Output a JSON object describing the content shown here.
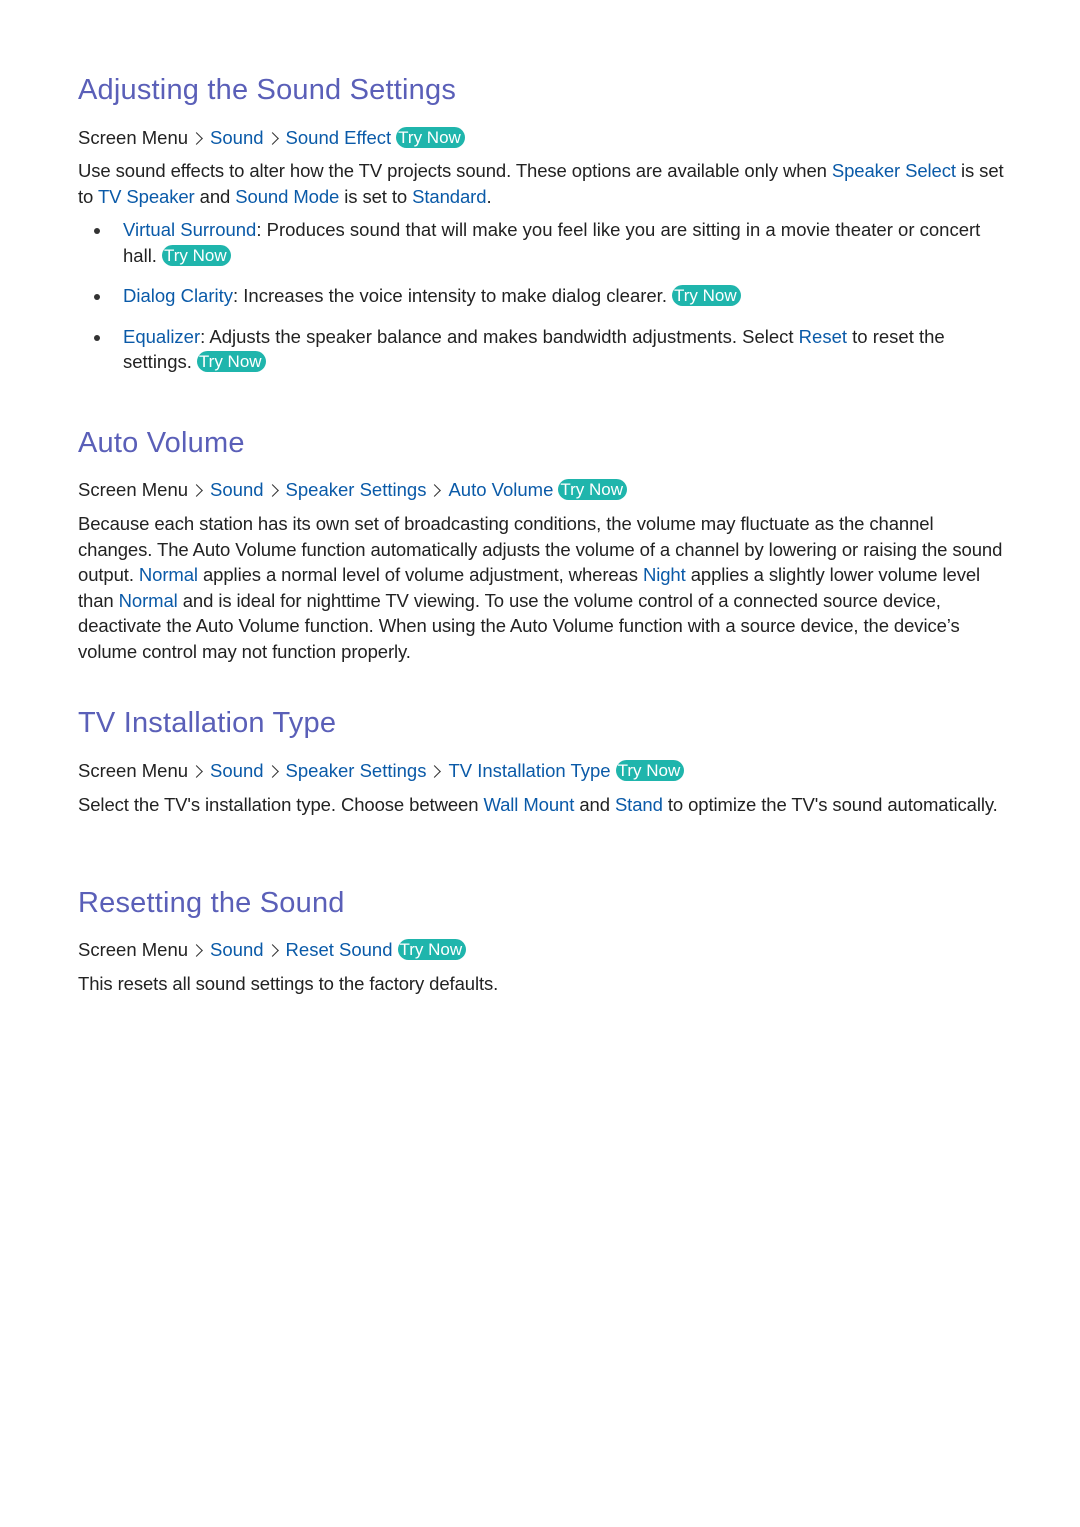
{
  "sections": [
    {
      "title": "Adjusting the Sound Settings",
      "breadcrumb": {
        "root": "Screen Menu",
        "items": [
          "Sound",
          "Sound Effect"
        ],
        "try_now": "Try Now"
      },
      "intro": {
        "t1": "Use sound effects to alter how the TV projects sound. These options are available only when ",
        "h1": "Speaker Select",
        "t2": " is set to ",
        "h2": "TV Speaker",
        "t3": " and ",
        "h3": "Sound Mode",
        "t4": " is set to ",
        "h4": "Standard",
        "t5": "."
      },
      "bullets": [
        {
          "term": "Virtual Surround",
          "text": ": Produces sound that will make you feel like you are sitting in a movie theater or concert hall.",
          "try_now": "Try Now"
        },
        {
          "term": "Dialog Clarity",
          "text": ": Increases the voice intensity to make dialog clearer.",
          "try_now": "Try Now"
        },
        {
          "term": "Equalizer",
          "text": ": Adjusts the speaker balance and makes bandwidth adjustments. Select ",
          "term2": "Reset",
          "text2": " to reset the settings.",
          "try_now": "Try Now"
        }
      ]
    },
    {
      "title": "Auto Volume",
      "breadcrumb": {
        "root": "Screen Menu",
        "items": [
          "Sound",
          "Speaker Settings",
          "Auto Volume"
        ],
        "try_now": "Try Now"
      },
      "body": {
        "t1": "Because each station has its own set of broadcasting conditions, the volume may fluctuate as the channel changes. The Auto Volume function automatically adjusts the volume of a channel by lowering or raising the sound output. ",
        "h1": "Normal",
        "t2": " applies a normal level of volume adjustment, whereas ",
        "h2": "Night",
        "t3": " applies a slightly lower volume level than ",
        "h3": "Normal",
        "t4": " and is ideal for nighttime TV viewing. To use the volume control of a connected source device, deactivate the Auto Volume function. When using the Auto Volume function with a source device, the device’s volume control may not function properly."
      }
    },
    {
      "title": "TV Installation Type",
      "breadcrumb": {
        "root": "Screen Menu",
        "items": [
          "Sound",
          "Speaker Settings",
          "TV Installation Type"
        ],
        "try_now": "Try Now"
      },
      "body": {
        "t1": "Select the TV's installation type. Choose between ",
        "h1": "Wall Mount",
        "t2": " and ",
        "h2": "Stand",
        "t3": " to optimize the TV's sound automatically."
      }
    },
    {
      "title": "Resetting the Sound",
      "breadcrumb": {
        "root": "Screen Menu",
        "items": [
          "Sound",
          "Reset Sound"
        ],
        "try_now": "Try Now"
      },
      "body": {
        "t1": "This resets all sound settings to the factory defaults."
      }
    }
  ],
  "colors": {
    "heading": "#5a5fb8",
    "link": "#0a5aa8",
    "try_now_bg": "#1fb5ac",
    "text": "#222222"
  }
}
